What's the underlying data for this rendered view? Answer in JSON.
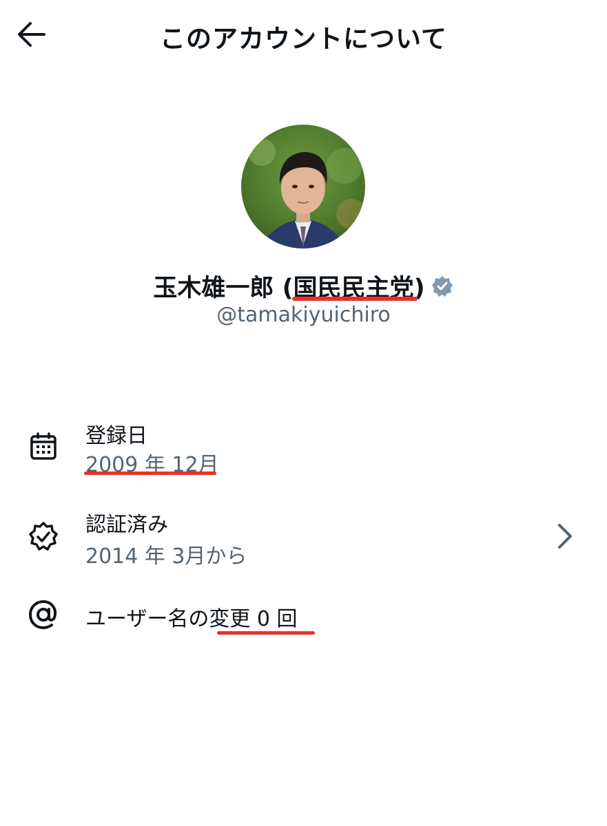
{
  "header": {
    "title": "このアカウントについて",
    "back_icon": "arrow-left-icon"
  },
  "profile": {
    "name_main": "玉木雄一郎 (",
    "name_party": "国民民主党",
    "name_close": ")",
    "handle": "@tamakiyuichiro",
    "verified_icon": "verified-badge-icon",
    "verified_color": "#829aab"
  },
  "info": {
    "joined": {
      "icon": "calendar-icon",
      "label": "登録日",
      "value": "2009 年 12月"
    },
    "verified": {
      "icon": "verified-check-icon",
      "label": "認証済み",
      "value": "2014 年 3月から",
      "chevron_icon": "chevron-right-icon"
    },
    "username": {
      "icon": "at-icon",
      "label": "ユーザー名の変更 0 回"
    }
  },
  "colors": {
    "text_primary": "#0f1419",
    "text_secondary": "#536471",
    "annotation_underline": "#e8312b"
  }
}
